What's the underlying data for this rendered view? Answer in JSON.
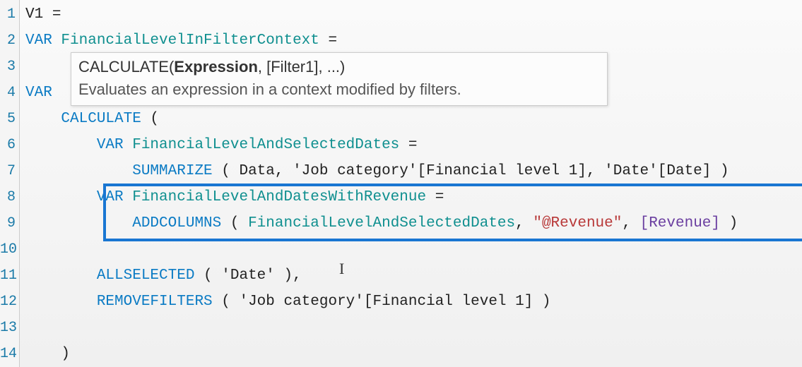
{
  "gutter": [
    "1",
    "2",
    "3",
    "4",
    "5",
    "6",
    "7",
    "8",
    "9",
    "10",
    "11",
    "12",
    "13",
    "14"
  ],
  "tooltip": {
    "sig_prefix": "CALCULATE(",
    "sig_bold": "Expression",
    "sig_suffix": ", [Filter1], ...)",
    "desc": "Evaluates an expression in a context modified by filters."
  },
  "lines": {
    "l1_a": "V1 ",
    "l1_b": "=",
    "l2_a": "VAR",
    "l2_b": " FinancialLevelInFilterContext ",
    "l2_c": "=",
    "l3": "",
    "l4_a": "VAR",
    "l5_a": "    CALCULATE",
    "l5_b": " (",
    "l6_a": "        VAR",
    "l6_b": " FinancialLevelAndSelectedDates ",
    "l6_c": "=",
    "l7_a": "            SUMMARIZE",
    "l7_b": " ( Data, 'Job category'[Financial level 1], 'Date'[Date] )",
    "l8_a": "        VAR",
    "l8_b": " FinancialLevelAndDatesWithRevenue ",
    "l8_c": "=",
    "l9_a": "            ADDCOLUMNS",
    "l9_b": " ( ",
    "l9_c": "FinancialLevelAndSelectedDates",
    "l9_d": ", ",
    "l9_e": "\"@Revenue\"",
    "l9_f": ", ",
    "l9_g": "[Revenue]",
    "l9_h": " )",
    "l10": "",
    "l11_a": "        ALLSELECTED",
    "l11_b": " ( 'Date' ),",
    "l12_a": "        REMOVEFILTERS",
    "l12_b": " ( 'Job category'[Financial level 1] )",
    "l13": "",
    "l14": "    )"
  },
  "cursor_glyph": "I"
}
